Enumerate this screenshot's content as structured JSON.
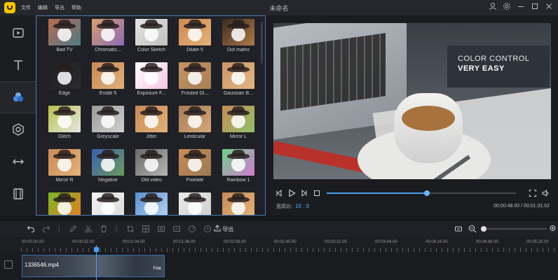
{
  "titlebar": {
    "menu": [
      "文件",
      "编辑",
      "导出",
      "帮助"
    ],
    "title": "未命名",
    "icons": [
      "user-icon",
      "settings-icon",
      "minimize-icon",
      "maximize-icon",
      "close-icon"
    ]
  },
  "rail": {
    "items": [
      {
        "name": "media",
        "icon": "media-icon"
      },
      {
        "name": "text",
        "icon": "text-icon"
      },
      {
        "name": "filters",
        "icon": "filters-icon",
        "active": true
      },
      {
        "name": "overlays",
        "icon": "overlays-icon"
      },
      {
        "name": "transitions",
        "icon": "transitions-icon"
      },
      {
        "name": "elements",
        "icon": "film-icon"
      }
    ]
  },
  "effects": {
    "items": [
      {
        "label": "Bad TV",
        "c1": "#b86c52",
        "c2": "#4f7a85"
      },
      {
        "label": "Chromatic...",
        "c1": "#d6a06f",
        "c2": "#8d6ab3"
      },
      {
        "label": "Color Sketch",
        "c1": "#e5e5e5",
        "c2": "#bfbfbf"
      },
      {
        "label": "Dilate 5",
        "c1": "#d08a52",
        "c2": "#e2b27a"
      },
      {
        "label": "Dot matrix",
        "c1": "#3a2b20",
        "c2": "#b07a4a"
      },
      {
        "label": "Edge",
        "c1": "#1f1f22",
        "c2": "#2c2c30"
      },
      {
        "label": "Erode 5",
        "c1": "#c88a56",
        "c2": "#e0b07a"
      },
      {
        "label": "Exposure F...",
        "c1": "#ffffff",
        "c2": "#f4c6e6"
      },
      {
        "label": "Frosted Gl...",
        "c1": "#c49366",
        "c2": "#a88056"
      },
      {
        "label": "Gaussian B...",
        "c1": "#c99366",
        "c2": "#e2b885"
      },
      {
        "label": "Glitch",
        "c1": "#b8c14a",
        "c2": "#e6e6e6"
      },
      {
        "label": "Greyscale",
        "c1": "#9a9a9a",
        "c2": "#cfcfcf"
      },
      {
        "label": "Jitter",
        "c1": "#c88a56",
        "c2": "#e2b27a"
      },
      {
        "label": "Lenticular",
        "c1": "#a77c5a",
        "c2": "#d4a779"
      },
      {
        "label": "Mirror L",
        "c1": "#c88a56",
        "c2": "#8fc06a"
      },
      {
        "label": "Mirror R",
        "c1": "#c88a56",
        "c2": "#e2b27a"
      },
      {
        "label": "Negative",
        "c1": "#3b5fb0",
        "c2": "#6b9a5c"
      },
      {
        "label": "Old video",
        "c1": "#6a6a6a",
        "c2": "#b5b5b5"
      },
      {
        "label": "Pixelate",
        "c1": "#c88a56",
        "c2": "#9b7a55"
      },
      {
        "label": "Rainbow 1",
        "c1": "#6fd18a",
        "c2": "#d37ad0"
      },
      {
        "label": "",
        "c1": "#7ab62a",
        "c2": "#e87b1f"
      },
      {
        "label": "",
        "c1": "#f2f2f2",
        "c2": "#dcdcdc"
      },
      {
        "label": "",
        "c1": "#5b8fd1",
        "c2": "#b8d4f2"
      },
      {
        "label": "",
        "c1": "#eaeaea",
        "c2": "#cfcfcf"
      },
      {
        "label": "",
        "c1": "#c88a56",
        "c2": "#e2b27a"
      }
    ]
  },
  "preview": {
    "caption_line1": "COLOR CONTROL",
    "caption_line2": "VERY EASY"
  },
  "playback": {
    "icons": [
      "prev-frame-icon",
      "play-icon",
      "next-frame-icon",
      "stop-icon",
      "fullscreen-icon",
      "volume-icon"
    ],
    "progress": 0.53,
    "ratio_label": "宽高比:",
    "ratio_value": "16 : 9",
    "time": "00:00:48.00 / 00:01:31.02"
  },
  "toolbar": {
    "export_label": "导出",
    "zoom": 0.0
  },
  "timeline": {
    "ticks": [
      "00:00:00.00",
      "00:00:32.00",
      "00:01:04.00",
      "00:01:36.00",
      "00:02:08.00",
      "00:02:40.00",
      "00:03:12.00",
      "00:03:44.00",
      "00:04:16.00",
      "00:04:48.00",
      "00:05:20.00"
    ],
    "clip_name": "1336546.mp4",
    "clip_tail": "Fide"
  },
  "colors": {
    "accent": "#4e9ff1",
    "brand": "#f5c400",
    "panel_border": "#4a78b0"
  }
}
